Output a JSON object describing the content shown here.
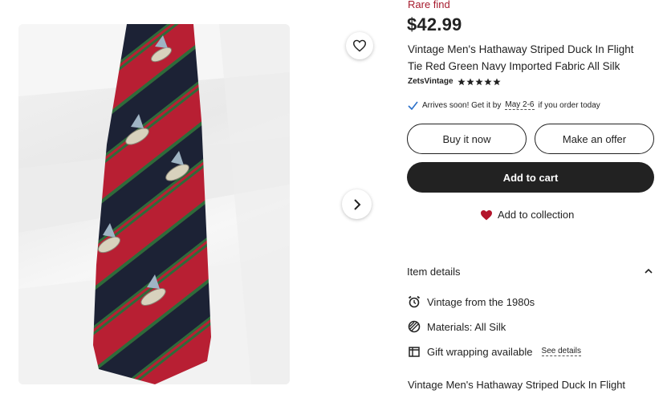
{
  "listing": {
    "badge": "Rare find",
    "price": "$42.99",
    "title": "Vintage Men's Hathaway Striped Duck In Flight Tie Red Green Navy Imported Fabric All Silk",
    "shop_name": "ZetsVintage",
    "rating_stars": 5
  },
  "shipping": {
    "prefix": "Arrives soon! Get it by",
    "dates": "May 2-6",
    "suffix": "if you order today"
  },
  "actions": {
    "buy_now": "Buy it now",
    "make_offer": "Make an offer",
    "add_to_cart": "Add to cart",
    "add_to_collection": "Add to collection"
  },
  "item_details": {
    "heading": "Item details",
    "rows": [
      {
        "icon": "alarm-clock-icon",
        "text": "Vintage from the 1980s"
      },
      {
        "icon": "materials-icon",
        "text": "Materials: All Silk"
      },
      {
        "icon": "gift-wrap-icon",
        "text": "Gift wrapping available",
        "link": "See details"
      }
    ]
  },
  "description_preview": "Vintage Men's Hathaway Striped Duck In Flight",
  "colors": {
    "badge": "#a61a2d",
    "heart": "#b3142b",
    "primary_button": "#222222",
    "tie_red": "#b81f33",
    "tie_navy": "#1c2235",
    "tie_green": "#2f6b3a"
  }
}
